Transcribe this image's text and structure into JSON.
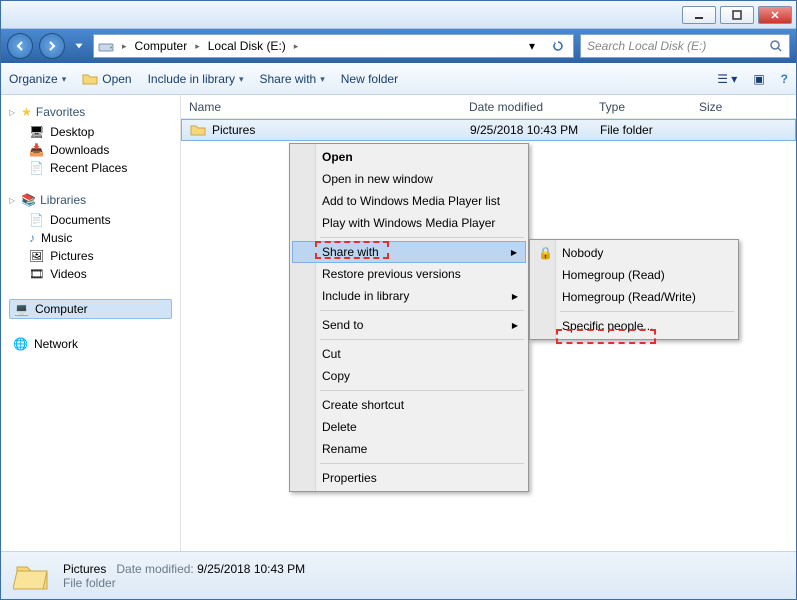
{
  "titlebar": {
    "min": "_",
    "max": "▢",
    "close": "✕"
  },
  "breadcrumb": {
    "seg1": "Computer",
    "seg2": "Local Disk (E:)"
  },
  "search": {
    "placeholder": "Search Local Disk (E:)"
  },
  "toolbar": {
    "organize": "Organize",
    "open": "Open",
    "include": "Include in library",
    "share": "Share with",
    "newfolder": "New folder"
  },
  "sidebar": {
    "favorites": "Favorites",
    "desktop": "Desktop",
    "downloads": "Downloads",
    "recent": "Recent Places",
    "libraries": "Libraries",
    "documents": "Documents",
    "music": "Music",
    "pictures": "Pictures",
    "videos": "Videos",
    "computer": "Computer",
    "network": "Network"
  },
  "columns": {
    "name": "Name",
    "date": "Date modified",
    "type": "Type",
    "size": "Size"
  },
  "row": {
    "name": "Pictures",
    "date": "9/25/2018 10:43 PM",
    "type": "File folder",
    "size": ""
  },
  "status": {
    "name": "Pictures",
    "date_label": "Date modified:",
    "date": "9/25/2018 10:43 PM",
    "type": "File folder"
  },
  "context": {
    "open": "Open",
    "newwin": "Open in new window",
    "wmplist": "Add to Windows Media Player list",
    "wmpplay": "Play with Windows Media Player",
    "share": "Share with",
    "restore": "Restore previous versions",
    "include": "Include in library",
    "sendto": "Send to",
    "cut": "Cut",
    "copy": "Copy",
    "shortcut": "Create shortcut",
    "delete": "Delete",
    "rename": "Rename",
    "props": "Properties"
  },
  "submenu": {
    "nobody": "Nobody",
    "hgread": "Homegroup (Read)",
    "hgrw": "Homegroup (Read/Write)",
    "specific": "Specific people..."
  }
}
